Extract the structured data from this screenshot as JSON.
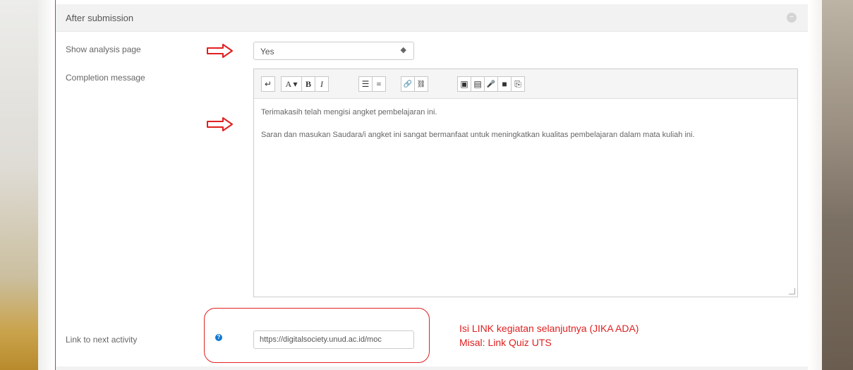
{
  "section": {
    "title": "After submission"
  },
  "fields": {
    "show_analysis_label": "Show analysis page",
    "show_analysis_value": "Yes",
    "completion_label": "Completion message",
    "next_activity_label": "Link to next activity",
    "next_activity_value": "https://digitalsociety.unud.ac.id/moc"
  },
  "editor": {
    "toolbar": [
      [
        "↵"
      ],
      [
        "A ▾",
        "B",
        "I"
      ],
      [
        "☰",
        "≡"
      ],
      [
        "🔗",
        "⛓"
      ],
      [
        "▣",
        "▤",
        "🎤",
        "■",
        "⎘"
      ]
    ],
    "paragraph1": "Terimakasih telah mengisi angket pembelajaran ini.",
    "paragraph2": "Saran dan masukan Saudara/i angket ini  sangat bermanfaat untuk meningkatkan kualitas pembelajaran dalam mata kuliah ini."
  },
  "annotation": {
    "line1": "Isi LINK kegiatan selanjutnya (JIKA ADA)",
    "line2": "Misal: Link Quiz UTS"
  },
  "colors": {
    "annotation": "#e02020",
    "help": "#1177d1"
  },
  "icons": {
    "collapse": "collapse-icon",
    "select_caret": "up-down-caret-icon",
    "help": "question-help-icon",
    "annotation_arrow": "red-outline-arrow-icon"
  }
}
